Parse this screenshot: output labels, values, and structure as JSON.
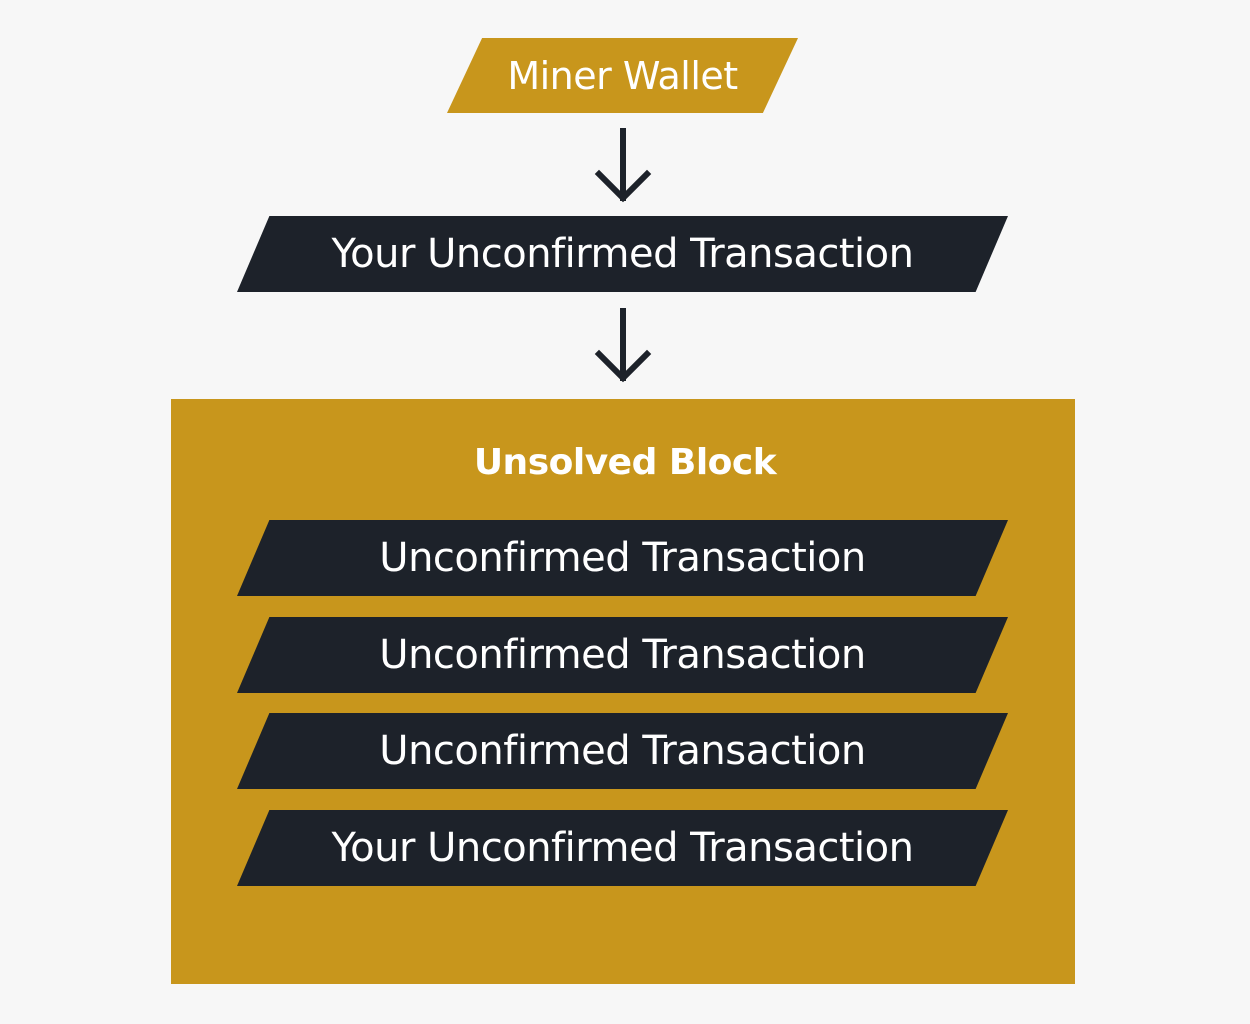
{
  "colors": {
    "background": "#f7f7f7",
    "gold": "#c8961c",
    "dark": "#1d222a",
    "text": "#ffffff"
  },
  "miner_wallet": {
    "label": "Miner Wallet"
  },
  "top_transaction": {
    "label": "Your Unconfirmed Transaction"
  },
  "arrows": [
    {
      "icon": "arrow-down-icon"
    },
    {
      "icon": "arrow-down-icon"
    }
  ],
  "block": {
    "title": "Unsolved Block",
    "transactions": [
      {
        "label": "Unconfirmed Transaction"
      },
      {
        "label": "Unconfirmed Transaction"
      },
      {
        "label": "Unconfirmed Transaction"
      },
      {
        "label": "Your Unconfirmed Transaction"
      }
    ]
  }
}
